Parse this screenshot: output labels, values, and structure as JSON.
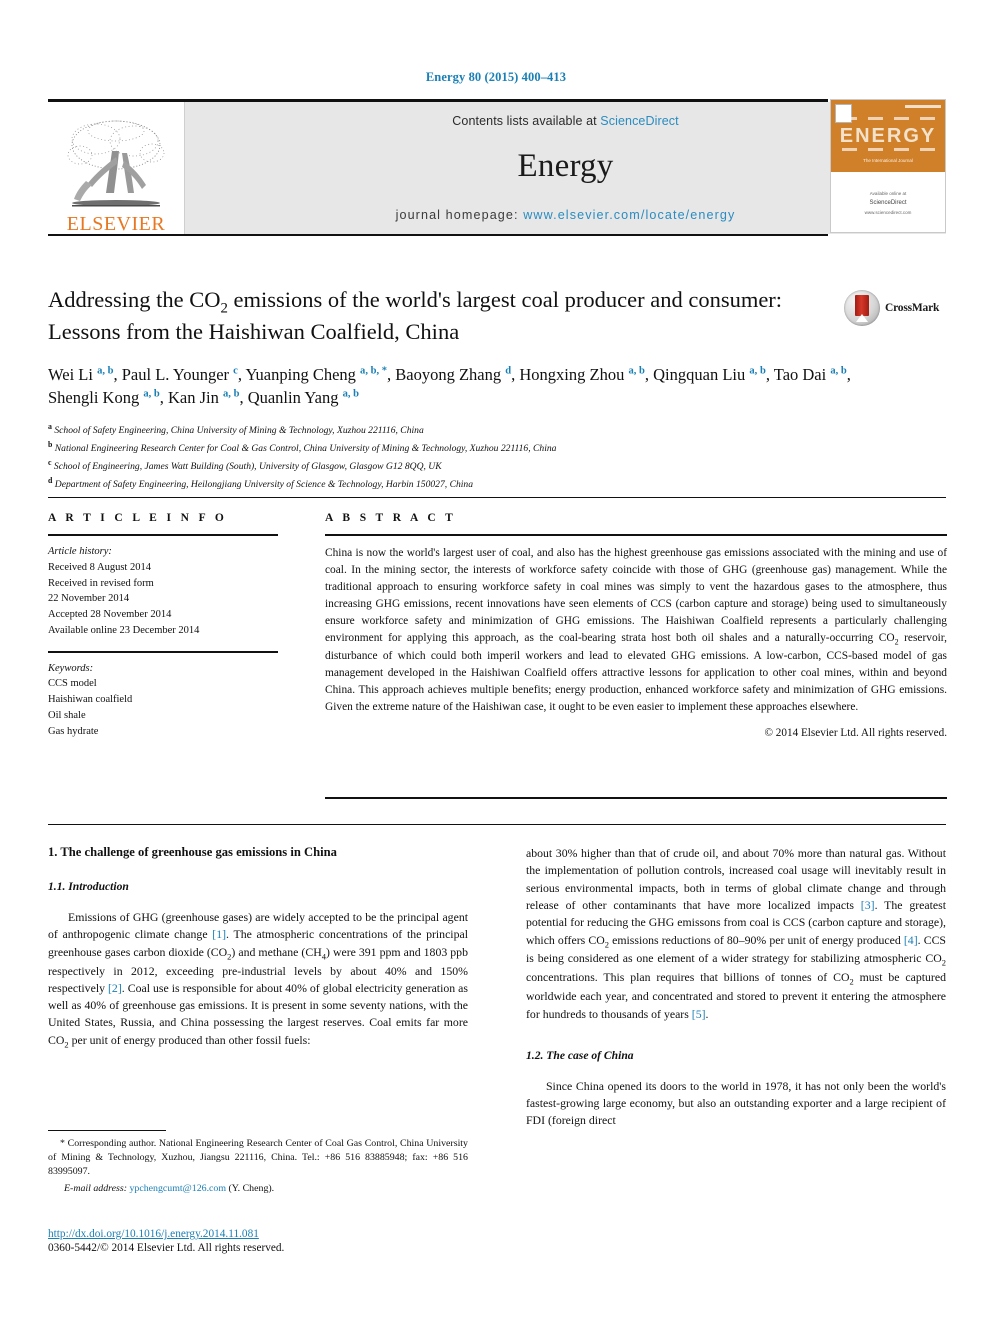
{
  "running_head": "Energy 80 (2015) 400–413",
  "masthead": {
    "contents_prefix": "Contents lists available at ",
    "contents_link": "ScienceDirect",
    "journal_name": "Energy",
    "homepage_prefix": "journal homepage: ",
    "homepage_url": "www.elsevier.com/locate/energy",
    "publisher": "ELSEVIER",
    "cover": {
      "title": "ENERGY",
      "subtitle": "The International Journal",
      "footer_small": "Available online at",
      "footer_brand": "ScienceDirect",
      "footer_url": "www.sciencedirect.com"
    }
  },
  "crossmark": {
    "label": "CrossMark"
  },
  "article": {
    "title_line1_pre": "Addressing the CO",
    "title_line1_sub": "2",
    "title_line1_post": " emissions of the world's largest coal producer",
    "title_line2": "and consumer: Lessons from the Haishiwan Coalfield, China",
    "authors": [
      {
        "name": "Wei Li",
        "marks": "a, b",
        "sep": ", "
      },
      {
        "name": "Paul L. Younger",
        "marks": "c",
        "sep": ", "
      },
      {
        "name": "Yuanping Cheng",
        "marks": "a, b, *",
        "sep": ", "
      },
      {
        "name": "Baoyong Zhang",
        "marks": "d",
        "sep": ", "
      },
      {
        "name": "Hongxing Zhou",
        "marks": "a, b",
        "sep": ", "
      },
      {
        "name": "Qingquan Liu",
        "marks": "a, b",
        "sep": ", "
      },
      {
        "name": "Tao Dai",
        "marks": "a, b",
        "sep": ", "
      },
      {
        "name": "Shengli Kong",
        "marks": "a, b",
        "sep": ", "
      },
      {
        "name": "Kan Jin",
        "marks": "a, b",
        "sep": ", "
      },
      {
        "name": "Quanlin Yang",
        "marks": "a, b",
        "sep": ""
      }
    ],
    "affiliations": [
      {
        "mark": "a",
        "text": "School of Safety Engineering, China University of Mining & Technology, Xuzhou 221116, China"
      },
      {
        "mark": "b",
        "text": "National Engineering Research Center for Coal & Gas Control, China University of Mining & Technology, Xuzhou 221116, China"
      },
      {
        "mark": "c",
        "text": "School of Engineering, James Watt Building (South), University of Glasgow, Glasgow G12 8QQ, UK"
      },
      {
        "mark": "d",
        "text": "Department of Safety Engineering, Heilongjiang University of Science & Technology, Harbin 150027, China"
      }
    ]
  },
  "article_info": {
    "heading": "A R T I C L E   I N F O",
    "history_label": "Article history:",
    "history": [
      "Received 8 August 2014",
      "Received in revised form",
      "22 November 2014",
      "Accepted 28 November 2014",
      "Available online 23 December 2014"
    ],
    "keywords_label": "Keywords:",
    "keywords": [
      "CCS model",
      "Haishiwan coalfield",
      "Oil shale",
      "Gas hydrate"
    ]
  },
  "abstract": {
    "heading": "A B S T R A C T",
    "part1": "China is now the world's largest user of coal, and also has the highest greenhouse gas emissions associated with the mining and use of coal. In the mining sector, the interests of workforce safety coincide with those of GHG (greenhouse gas) management. While the traditional approach to ensuring workforce safety in coal mines was simply to vent the hazardous gases to the atmosphere, thus increasing GHG emissions, recent innovations have seen elements of CCS (carbon capture and storage) being used to simultaneously ensure workforce safety and minimization of GHG emissions. The Haishiwan Coalfield represents a particularly challenging environment for applying this approach, as the coal-bearing strata host both oil shales and a naturally-occurring CO",
    "sub1": "2",
    "part2": " reservoir, disturbance of which could both imperil workers and lead to elevated GHG emissions. A low-carbon, CCS-based model of gas management developed in the Haishiwan Coalfield offers attractive lessons for application to other coal mines, within and beyond China. This approach achieves multiple benefits; energy production, enhanced workforce safety and minimization of GHG emissions. Given the extreme nature of the Haishiwan case, it ought to be even easier to implement these approaches elsewhere.",
    "copyright": "© 2014 Elsevier Ltd. All rights reserved."
  },
  "body": {
    "section1_heading": "1. The challenge of greenhouse gas emissions in China",
    "sub11_heading": "1.1. Introduction",
    "left_p1_a": "Emissions of GHG (greenhouse gases) are widely accepted to be the principal agent of anthropogenic climate change ",
    "left_ref1": "[1]",
    "left_p1_b": ". The atmospheric concentrations of the principal greenhouse gases carbon dioxide (CO",
    "left_sub1": "2",
    "left_p1_c": ") and methane (CH",
    "left_sub2": "4",
    "left_p1_d": ") were 391 ppm and 1803 ppb respectively in 2012, exceeding pre-industrial levels by about 40% and 150% respectively ",
    "left_ref2": "[2]",
    "left_p1_e": ". Coal use is responsible for about 40% of global electricity generation as well as 40% of greenhouse gas emissions. It is present in some seventy nations, with the United States, Russia, and China possessing the largest reserves. Coal emits far more CO",
    "left_sub3": "2",
    "left_p1_f": " per unit of energy produced than other fossil fuels:",
    "right_p1_a": "about 30% higher than that of crude oil, and about 70% more than natural gas. Without the implementation of pollution controls, increased coal usage will inevitably result in serious environmental impacts, both in terms of global climate change and through release of other contaminants that have more localized impacts ",
    "right_ref3": "[3]",
    "right_p1_b": ". The greatest potential for reducing the GHG emissons from coal is CCS (carbon capture and storage), which offers CO",
    "right_sub1": "2",
    "right_p1_c": " emissions reductions of 80–90% per unit of energy produced ",
    "right_ref4": "[4]",
    "right_p1_d": ". CCS is being considered as one element of a wider strategy for stabilizing atmospheric CO",
    "right_sub2": "2",
    "right_p1_e": " concentrations. This plan requires that billions of tonnes of CO",
    "right_sub3": "2",
    "right_p1_f": " must be captured worldwide each year, and concentrated and stored to prevent it entering the atmosphere for hundreds to thousands of years ",
    "right_ref5": "[5]",
    "right_p1_g": ".",
    "sub12_heading": "1.2. The case of China",
    "right_p2": "Since China opened its doors to the world in 1978, it has not only been the world's fastest-growing large economy, but also an outstanding exporter and a large recipient of FDI (foreign direct"
  },
  "footnote": {
    "star": "*",
    "corresponding": " Corresponding author. National Engineering Research Center of Coal Gas Control, China University of Mining & Technology, Xuzhou, Jiangsu 221116, China. Tel.: +86 516 83885948; fax: +86 516 83995097.",
    "email_label": "E-mail address:",
    "email": "ypchengcumt@126.com",
    "email_suffix": " (Y. Cheng)."
  },
  "doi": {
    "url": "http://dx.doi.org/10.1016/j.energy.2014.11.081",
    "issn": "0360-5442/© 2014 Elsevier Ltd. All rights reserved."
  },
  "colors": {
    "link": "#1a7fb5",
    "elsevier_orange": "#E87722",
    "cover_orange": "#d1802a"
  }
}
